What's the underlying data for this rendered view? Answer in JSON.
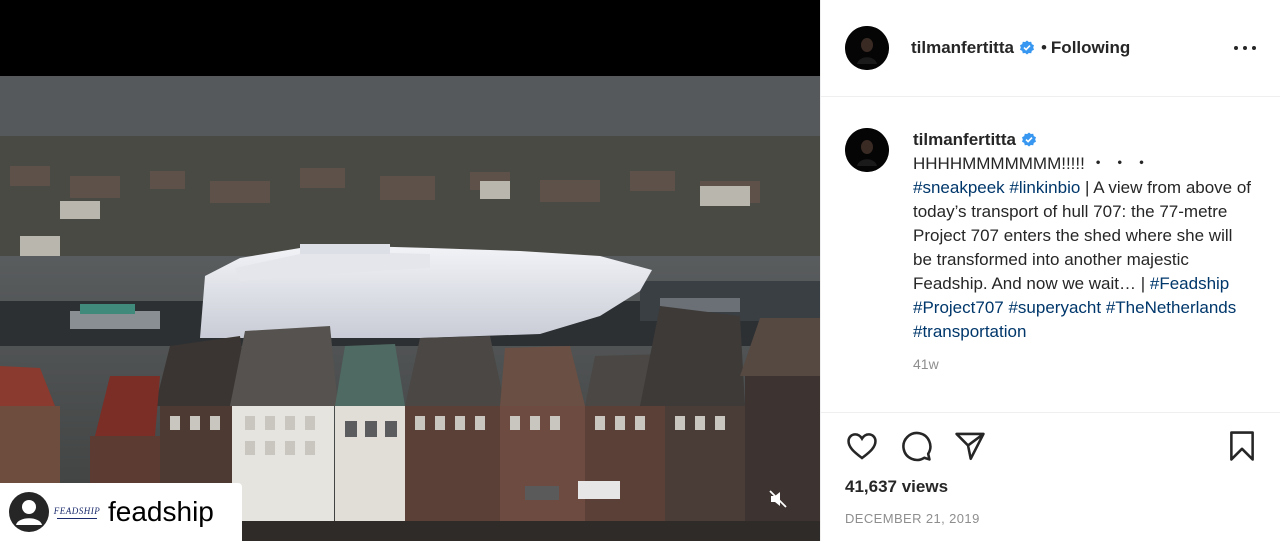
{
  "post": {
    "username": "tilmanfertitta",
    "following_label": "Following",
    "separator": "•",
    "caption_title": "HHHHMMMMMMM!!!!!  ・ ・ ・",
    "caption_parts": [
      {
        "type": "tag",
        "text": "#sneakpeek"
      },
      {
        "type": "text",
        "text": " "
      },
      {
        "type": "tag",
        "text": "#linkinbio"
      },
      {
        "type": "text",
        "text": " | A view from above of today’s transport of hull 707: the 77-metre Project 707 enters the shed where she will be transformed into another majestic Feadship. And now we wait… | "
      },
      {
        "type": "tag",
        "text": "#Feadship"
      },
      {
        "type": "text",
        "text": " "
      },
      {
        "type": "tag",
        "text": "#Project707"
      },
      {
        "type": "text",
        "text": " "
      },
      {
        "type": "tag",
        "text": "#superyacht"
      },
      {
        "type": "text",
        "text": " "
      },
      {
        "type": "tag",
        "text": "#TheNetherlands"
      },
      {
        "type": "text",
        "text": " "
      },
      {
        "type": "tag",
        "text": "#transportation"
      }
    ],
    "time_ago": "41w",
    "views": "41,637 views",
    "date": "DECEMBER 21, 2019"
  },
  "media": {
    "tag_logo_text": "FEADSHIP",
    "tag_name": "feadship"
  },
  "colors": {
    "verified": "#3897f0",
    "hashtag": "#00376b",
    "muted_text": "#8e8e8e"
  },
  "icons": [
    "verified-badge-icon",
    "more-options-icon",
    "heart-icon",
    "comment-icon",
    "share-icon",
    "bookmark-icon",
    "mute-icon",
    "user-icon"
  ]
}
